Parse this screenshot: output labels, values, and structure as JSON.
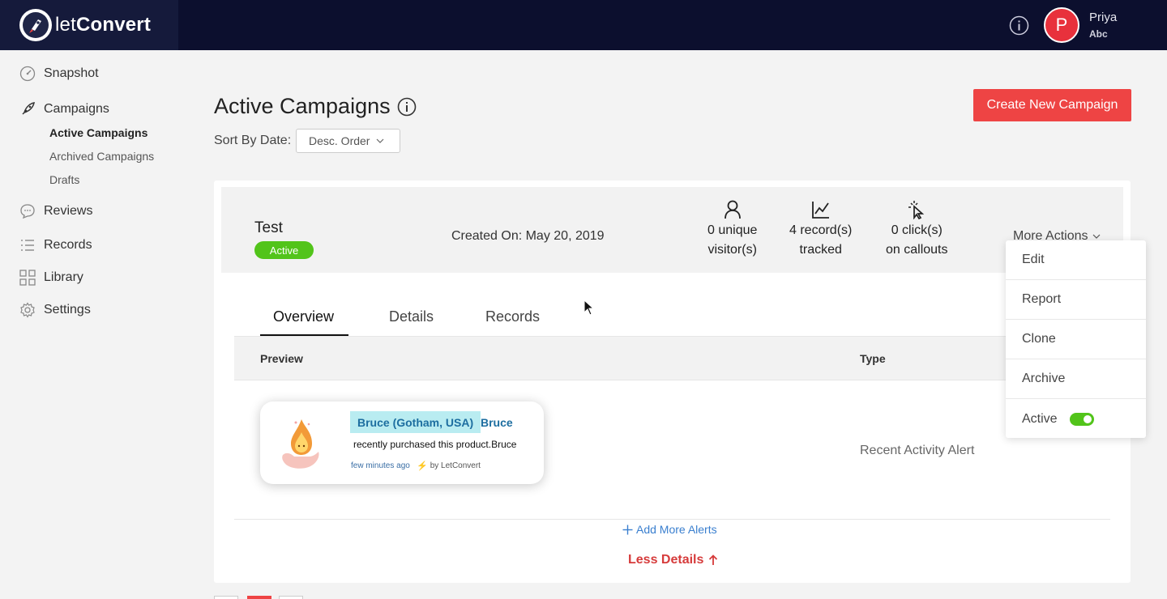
{
  "app": {
    "brand_light": "let",
    "brand_bold": "Convert"
  },
  "user": {
    "initial": "P",
    "name": "Priya",
    "org": "Abc"
  },
  "sidebar": {
    "items": [
      {
        "label": "Snapshot",
        "icon": "gauge-icon"
      },
      {
        "label": "Campaigns",
        "icon": "rocket-icon"
      },
      {
        "label": "Reviews",
        "icon": "chat-bubble-icon"
      },
      {
        "label": "Records",
        "icon": "list-icon"
      },
      {
        "label": "Library",
        "icon": "grid-icon"
      },
      {
        "label": "Settings",
        "icon": "gear-icon"
      }
    ],
    "sub_items": [
      {
        "label": "Active Campaigns",
        "active": true
      },
      {
        "label": "Archived Campaigns",
        "active": false
      },
      {
        "label": "Drafts",
        "active": false
      }
    ]
  },
  "page": {
    "title": "Active Campaigns",
    "sort_label": "Sort By Date:",
    "sort_value": "Desc. Order",
    "create_button": "Create New Campaign"
  },
  "campaign": {
    "name": "Test",
    "status": "Active",
    "created": "Created On: May 20, 2019",
    "stats": [
      {
        "line1": "0 unique",
        "line2": "visitor(s)",
        "icon": "user-icon"
      },
      {
        "line1": "4 record(s)",
        "line2": "tracked",
        "icon": "line-chart-icon"
      },
      {
        "line1": "0 click(s)",
        "line2": "on callouts",
        "icon": "pointer-click-icon"
      }
    ],
    "more_actions": "More Actions",
    "tabs": [
      "Overview",
      "Details",
      "Records"
    ],
    "active_tab": "Overview",
    "columns": {
      "preview": "Preview",
      "type": "Type"
    },
    "preview": {
      "name_highlight": "Bruce (Gotham, USA)",
      "name_extra": "Bruce",
      "message": "recently purchased this product.Bruce",
      "time": "few minutes ago",
      "by": "by LetConvert"
    },
    "type_value": "Recent Activity Alert",
    "add_alerts": "Add More Alerts",
    "less_details": "Less Details"
  },
  "dropdown": {
    "items": [
      "Edit",
      "Report",
      "Clone",
      "Archive",
      "Active"
    ],
    "active_toggle": true
  },
  "colors": {
    "topbar": "#0c0f2e",
    "accent_red": "#ee4444",
    "status_green": "#52c41a",
    "link_blue": "#3a7fcf"
  }
}
